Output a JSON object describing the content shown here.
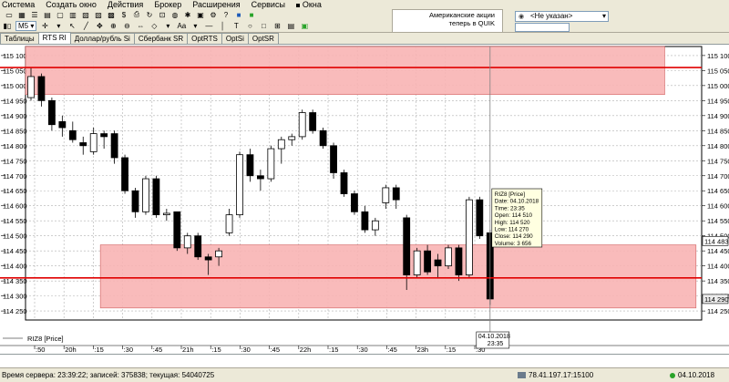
{
  "menu": [
    "Система",
    "Создать окно",
    "Действия",
    "Брокер",
    "Расширения",
    "Сервисы",
    "Окна"
  ],
  "toolbar": {
    "interval": "M5",
    "font_label": "Aa"
  },
  "promo": {
    "line1": "Американские акции",
    "line2": "теперь в QUIK"
  },
  "client_select": "<Не указан>",
  "tabs": [
    {
      "label": "Таблицы",
      "active": false
    },
    {
      "label": "RTS RI",
      "active": true
    },
    {
      "label": "Доллар/рубль Si",
      "active": false
    },
    {
      "label": "Сбербанк SR",
      "active": false
    },
    {
      "label": "OptRTS",
      "active": false
    },
    {
      "label": "OptSi",
      "active": false
    },
    {
      "label": "OptSR",
      "active": false
    }
  ],
  "chart": {
    "legend": "RIZ8 [Price]",
    "colors": {
      "up": "#ffffff",
      "down": "#000000",
      "zone": "#f8b4b4",
      "line": "#e00000"
    },
    "last_price": "114 483",
    "close_price": "114 290",
    "crosshair_date": "04.10.2018",
    "crosshair_time": "23:35",
    "x_labels": [
      ":50",
      "20h",
      ":15",
      ":30",
      ":45",
      "21h",
      ":15",
      ":30",
      ":45",
      "22h",
      ":15",
      ":30",
      ":45",
      "23h",
      ":15",
      ":30"
    ],
    "tooltip": [
      "RIZ8 [Price]",
      "Date: 04.10.2018",
      "Time: 23:35",
      "Open:  114 510",
      "High:  114 520",
      "Low:    114 270",
      "Close: 114 290",
      "Volume: 3 656"
    ]
  },
  "chart_data": {
    "type": "candlestick",
    "y_ticks": [
      "115 100",
      "115 050",
      "115 000",
      "114 950",
      "114 900",
      "114 850",
      "114 800",
      "114 750",
      "114 700",
      "114 650",
      "114 600",
      "114 550",
      "114 500",
      "114 450",
      "114 400",
      "114 350",
      "114 300",
      "114 250"
    ],
    "ylim": [
      114220,
      115130
    ],
    "red_lines": [
      115060,
      114360
    ],
    "zones": [
      {
        "from": 114970,
        "to": 115130,
        "x_from": 0,
        "x_to": 61
      },
      {
        "from": 114260,
        "to": 114470,
        "x_from": 7,
        "x_to": 64
      }
    ],
    "candles": [
      {
        "o": 114960,
        "h": 115060,
        "l": 114950,
        "c": 115030
      },
      {
        "o": 115030,
        "h": 115040,
        "l": 114930,
        "c": 114950
      },
      {
        "o": 114950,
        "h": 114960,
        "l": 114850,
        "c": 114870
      },
      {
        "o": 114880,
        "h": 114900,
        "l": 114830,
        "c": 114860
      },
      {
        "o": 114850,
        "h": 114880,
        "l": 114810,
        "c": 114820
      },
      {
        "o": 114810,
        "h": 114830,
        "l": 114770,
        "c": 114800
      },
      {
        "o": 114780,
        "h": 114860,
        "l": 114770,
        "c": 114840
      },
      {
        "o": 114840,
        "h": 114850,
        "l": 114790,
        "c": 114830
      },
      {
        "o": 114840,
        "h": 114850,
        "l": 114740,
        "c": 114760
      },
      {
        "o": 114760,
        "h": 114770,
        "l": 114640,
        "c": 114650
      },
      {
        "o": 114650,
        "h": 114660,
        "l": 114560,
        "c": 114580
      },
      {
        "o": 114580,
        "h": 114700,
        "l": 114570,
        "c": 114690
      },
      {
        "o": 114690,
        "h": 114700,
        "l": 114560,
        "c": 114570
      },
      {
        "o": 114570,
        "h": 114590,
        "l": 114550,
        "c": 114575
      },
      {
        "o": 114580,
        "h": 114580,
        "l": 114450,
        "c": 114460
      },
      {
        "o": 114460,
        "h": 114510,
        "l": 114440,
        "c": 114500
      },
      {
        "o": 114500,
        "h": 114510,
        "l": 114420,
        "c": 114430
      },
      {
        "o": 114430,
        "h": 114440,
        "l": 114370,
        "c": 114420
      },
      {
        "o": 114430,
        "h": 114460,
        "l": 114400,
        "c": 114450
      },
      {
        "o": 114510,
        "h": 114590,
        "l": 114500,
        "c": 114570
      },
      {
        "o": 114570,
        "h": 114780,
        "l": 114560,
        "c": 114770
      },
      {
        "o": 114770,
        "h": 114790,
        "l": 114680,
        "c": 114700
      },
      {
        "o": 114700,
        "h": 114720,
        "l": 114650,
        "c": 114690
      },
      {
        "o": 114690,
        "h": 114800,
        "l": 114680,
        "c": 114790
      },
      {
        "o": 114790,
        "h": 114830,
        "l": 114740,
        "c": 114820
      },
      {
        "o": 114820,
        "h": 114840,
        "l": 114800,
        "c": 114830
      },
      {
        "o": 114830,
        "h": 114920,
        "l": 114820,
        "c": 114910
      },
      {
        "o": 114910,
        "h": 114920,
        "l": 114840,
        "c": 114850
      },
      {
        "o": 114850,
        "h": 114860,
        "l": 114790,
        "c": 114800
      },
      {
        "o": 114800,
        "h": 114810,
        "l": 114690,
        "c": 114710
      },
      {
        "o": 114710,
        "h": 114720,
        "l": 114630,
        "c": 114640
      },
      {
        "o": 114640,
        "h": 114650,
        "l": 114570,
        "c": 114580
      },
      {
        "o": 114580,
        "h": 114600,
        "l": 114510,
        "c": 114520
      },
      {
        "o": 114520,
        "h": 114560,
        "l": 114500,
        "c": 114550
      },
      {
        "o": 114610,
        "h": 114670,
        "l": 114590,
        "c": 114660
      },
      {
        "o": 114660,
        "h": 114670,
        "l": 114590,
        "c": 114620
      },
      {
        "o": 114560,
        "h": 114570,
        "l": 114320,
        "c": 114370
      },
      {
        "o": 114370,
        "h": 114460,
        "l": 114360,
        "c": 114450
      },
      {
        "o": 114450,
        "h": 114470,
        "l": 114370,
        "c": 114380
      },
      {
        "o": 114420,
        "h": 114440,
        "l": 114360,
        "c": 114400
      },
      {
        "o": 114400,
        "h": 114470,
        "l": 114390,
        "c": 114460
      },
      {
        "o": 114460,
        "h": 114470,
        "l": 114350,
        "c": 114370
      },
      {
        "o": 114370,
        "h": 114630,
        "l": 114360,
        "c": 114620
      },
      {
        "o": 114620,
        "h": 114630,
        "l": 114490,
        "c": 114500
      },
      {
        "o": 114510,
        "h": 114520,
        "l": 114270,
        "c": 114290
      }
    ]
  }
}
